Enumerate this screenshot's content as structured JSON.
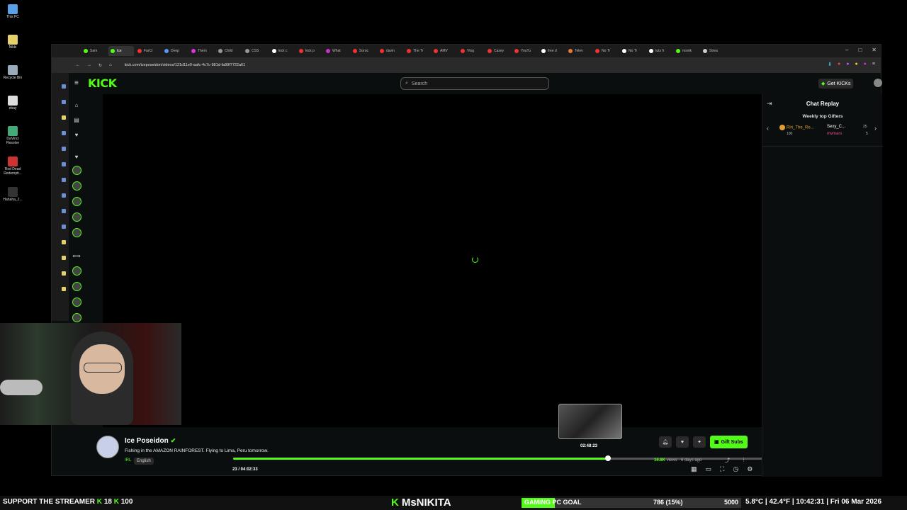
{
  "desktop": {
    "icons": [
      {
        "label": "This PC",
        "color": "#5aa0e6"
      },
      {
        "label": "Nikki",
        "color": "#e6d06a"
      },
      {
        "label": "Recycle Bin",
        "color": "#9ab"
      },
      {
        "label": "ebay",
        "color": "#ddd"
      },
      {
        "label": "DaVinci Resolve",
        "color": "#4a7"
      },
      {
        "label": "Red Dead Redempti...",
        "color": "#c33"
      },
      {
        "label": "Hahaha_2...",
        "color": "#333"
      }
    ]
  },
  "browser": {
    "tabs": [
      {
        "label": "Sam",
        "color": "#53fc18"
      },
      {
        "label": "Ice",
        "color": "#53fc18",
        "active": true
      },
      {
        "label": "FarCr",
        "color": "#e33"
      },
      {
        "label": "Deep",
        "color": "#59f"
      },
      {
        "label": "Them",
        "color": "#d3d"
      },
      {
        "label": "Child",
        "color": "#999"
      },
      {
        "label": "CSS",
        "color": "#999"
      },
      {
        "label": "kick c",
        "color": "#fff"
      },
      {
        "label": "kick p",
        "color": "#e33"
      },
      {
        "label": "What",
        "color": "#c3c"
      },
      {
        "label": "Soroc",
        "color": "#e33"
      },
      {
        "label": "davin",
        "color": "#e33"
      },
      {
        "label": "The Tr",
        "color": "#e33"
      },
      {
        "label": "AMV",
        "color": "#e33"
      },
      {
        "label": "Vlog",
        "color": "#e33"
      },
      {
        "label": "Casey",
        "color": "#e33"
      },
      {
        "label": "YouTu",
        "color": "#e33"
      },
      {
        "label": "free d",
        "color": "#fff"
      },
      {
        "label": "Telev",
        "color": "#e73"
      },
      {
        "label": "No Tr",
        "color": "#e33"
      },
      {
        "label": "No Tr",
        "color": "#fff"
      },
      {
        "label": "tuts fr",
        "color": "#fff"
      },
      {
        "label": "msnik",
        "color": "#53fc18"
      },
      {
        "label": "Strea",
        "color": "#ccc"
      }
    ],
    "url": "kick.com/iceposeidon/videos/121d11e0-aafc-4c7c-981d-fa99f7722a61"
  },
  "kick": {
    "logo": "KICK",
    "search_placeholder": "Search",
    "get_kicks": "Get KICKs"
  },
  "player": {
    "preview_time": "02:48:23",
    "timecode": "23 / 04:02:33",
    "progress": 0.6945
  },
  "chat": {
    "title": "Chat Replay",
    "gifters_title": "Weekly top Gifters",
    "gifter1_name": "Riri_The_Re...",
    "gifter1_count": "100",
    "gifter2_name": "Sexy_C...",
    "gifter2_count": "25",
    "gifter3_name": "mvmars",
    "gifter3_count": "5"
  },
  "stream": {
    "streamer": "Ice Poseidon",
    "title": "Fishing in the AMAZON RAINFOREST. Flying to Lima, Peru tomorrow.",
    "category": "IRL",
    "language": "English",
    "views": "16.8K",
    "views_suffix": "views · 6 days ago",
    "gift_subs": "Gift Subs"
  },
  "taskbar": {
    "support_text": "SUPPORT THE STREAMER",
    "counter1": "18",
    "counter2": "100",
    "kick_name": "MsNIKITA",
    "goal_label": "GAMING PC GOAL",
    "goal_value": "786 (15%)",
    "goal_fraction": 0.15,
    "goal_total": "5000",
    "weather_time": "5.8°C | 42.4°F | 10:42:31 | Fri 06 Mar 2026"
  }
}
